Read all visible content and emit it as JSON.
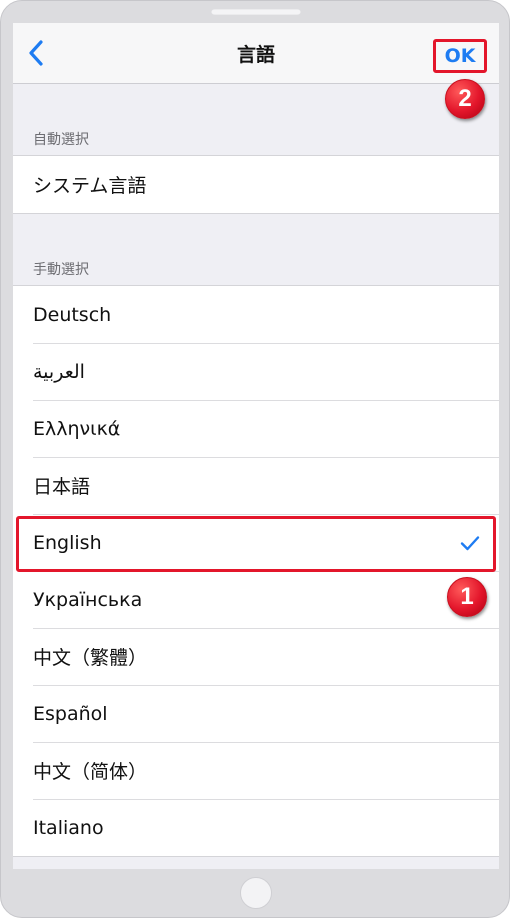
{
  "nav": {
    "title": "言語",
    "ok_label": "OK"
  },
  "sections": {
    "auto": {
      "header": "自動選択",
      "items": [
        {
          "label": "システム言語"
        }
      ]
    },
    "manual": {
      "header": "手動選択",
      "items": [
        {
          "label": "Deutsch"
        },
        {
          "label": "العربية"
        },
        {
          "label": "Ελληνικά"
        },
        {
          "label": "日本語"
        },
        {
          "label": "English",
          "selected": true
        },
        {
          "label": "Українська"
        },
        {
          "label": "中文（繁體）"
        },
        {
          "label": "Español"
        },
        {
          "label": "中文（简体）"
        },
        {
          "label": "Italiano"
        }
      ]
    }
  },
  "annotations": {
    "step1": "1",
    "step2": "2"
  },
  "colors": {
    "accent": "#1e7cf2",
    "highlight": "#e3162b"
  },
  "icons": {
    "back": "chevron-left-icon",
    "check": "checkmark-icon"
  }
}
